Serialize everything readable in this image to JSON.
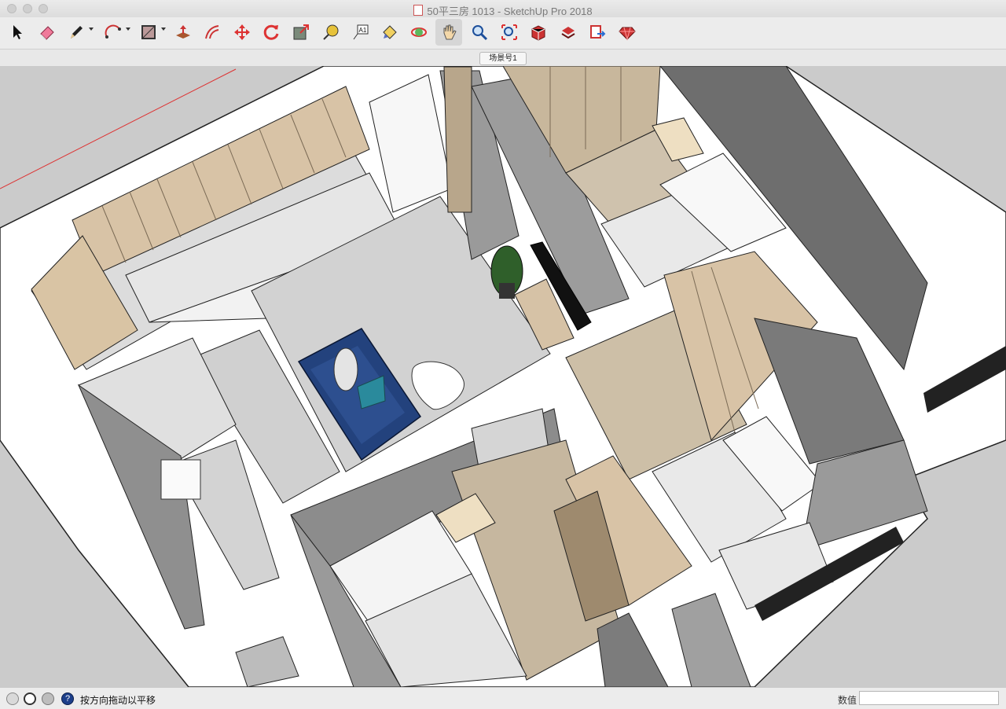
{
  "window": {
    "title": "50平三房 1013 - SketchUp Pro 2018"
  },
  "toolbar": {
    "tools": [
      {
        "name": "select-tool",
        "icon": "arrow-cursor-icon"
      },
      {
        "name": "eraser-tool",
        "icon": "eraser-icon"
      },
      {
        "name": "line-tool",
        "icon": "pencil-icon",
        "has_dropdown": true
      },
      {
        "name": "arc-tool",
        "icon": "arc-icon",
        "has_dropdown": true
      },
      {
        "name": "rectangle-tool",
        "icon": "rectangle-icon",
        "has_dropdown": true
      },
      {
        "name": "push-pull-tool",
        "icon": "push-pull-icon"
      },
      {
        "name": "offset-tool",
        "icon": "offset-icon"
      },
      {
        "name": "move-tool",
        "icon": "move-arrows-icon"
      },
      {
        "name": "rotate-tool",
        "icon": "rotate-icon"
      },
      {
        "name": "scale-tool",
        "icon": "scale-icon"
      },
      {
        "name": "tape-measure-tool",
        "icon": "tape-measure-icon"
      },
      {
        "name": "text-tool",
        "icon": "text-a1-icon"
      },
      {
        "name": "paint-bucket-tool",
        "icon": "paint-bucket-icon"
      },
      {
        "name": "orbit-tool",
        "icon": "orbit-icon"
      },
      {
        "name": "pan-tool",
        "icon": "hand-icon",
        "active": true
      },
      {
        "name": "zoom-tool",
        "icon": "magnifier-icon"
      },
      {
        "name": "zoom-extents-tool",
        "icon": "zoom-extents-icon"
      },
      {
        "name": "3d-warehouse-tool",
        "icon": "warehouse-icon"
      },
      {
        "name": "extension-warehouse-tool",
        "icon": "extension-warehouse-icon"
      },
      {
        "name": "share-model-tool",
        "icon": "share-model-icon"
      },
      {
        "name": "send-to-layout-tool",
        "icon": "send-to-layout-icon"
      },
      {
        "name": "extension-manager-tool",
        "icon": "ruby-gem-icon"
      }
    ]
  },
  "scenes": {
    "tabs": [
      "场景号1"
    ]
  },
  "colors": {
    "wall_top": "#ffffff",
    "wall_side": "#8e8e8e",
    "wood": "#d6c2a6",
    "floor_tile": "#d5d5d5",
    "sofa": "#23427d",
    "background": "#cbcbcb"
  },
  "status": {
    "hint": "按方向拖动以平移",
    "measurements_label": "数值",
    "measurements_value": ""
  }
}
